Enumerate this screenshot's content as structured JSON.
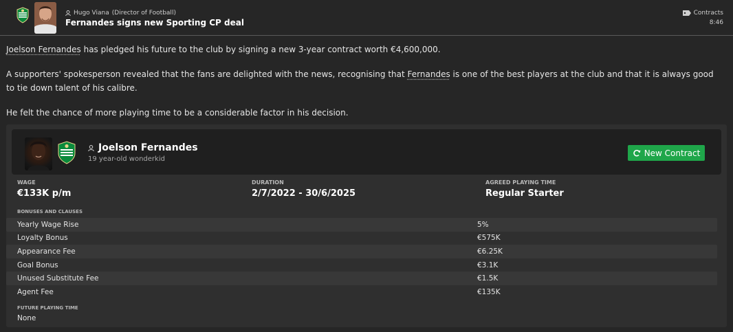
{
  "header": {
    "sender_name": "Hugo Viana",
    "sender_role": "(Director of Football)",
    "subject": "Fernandes signs new Sporting CP deal",
    "category": "Contracts",
    "time": "8:46"
  },
  "body": {
    "p1_name": "Joelson Fernandes",
    "p1_text": " has pledged his future to the club by signing a new 3-year contract worth €4,600,000.",
    "p2_text_a": "A supporters' spokesperson revealed that the fans are delighted with the news, recognising that ",
    "p2_name": "Fernandes",
    "p2_text_b": " is one of the best players at the club and that it is always good to tie down talent of his calibre.",
    "p3_text": "He felt the chance of more playing time to be a considerable factor in his decision."
  },
  "player": {
    "name": "Joelson Fernandes",
    "subtitle": "19 year-old wonderkid",
    "new_contract_label": "New Contract"
  },
  "contract": {
    "wage_label": "WAGE",
    "wage_value": "€133K p/m",
    "duration_label": "DURATION",
    "duration_value": "2/7/2022 - 30/6/2025",
    "playing_time_label": "AGREED PLAYING TIME",
    "playing_time_value": "Regular Starter",
    "bonuses_label": "BONUSES AND CLAUSES",
    "clauses": [
      {
        "name": "Yearly Wage Rise",
        "value": "5%"
      },
      {
        "name": "Loyalty Bonus",
        "value": "€575K"
      },
      {
        "name": "Appearance Fee",
        "value": "€6.25K"
      },
      {
        "name": "Goal Bonus",
        "value": "€3.1K"
      },
      {
        "name": "Unused Substitute Fee",
        "value": "€1.5K"
      },
      {
        "name": "Agent Fee",
        "value": "€135K"
      }
    ],
    "future_label": "FUTURE PLAYING TIME",
    "future_value": "None"
  },
  "colors": {
    "accent_green": "#1fa64a",
    "background": "#262626",
    "club_green": "#0a8a3c"
  },
  "icons": {
    "category": "contract-tag-icon",
    "person": "person-icon",
    "refresh": "refresh-icon"
  }
}
